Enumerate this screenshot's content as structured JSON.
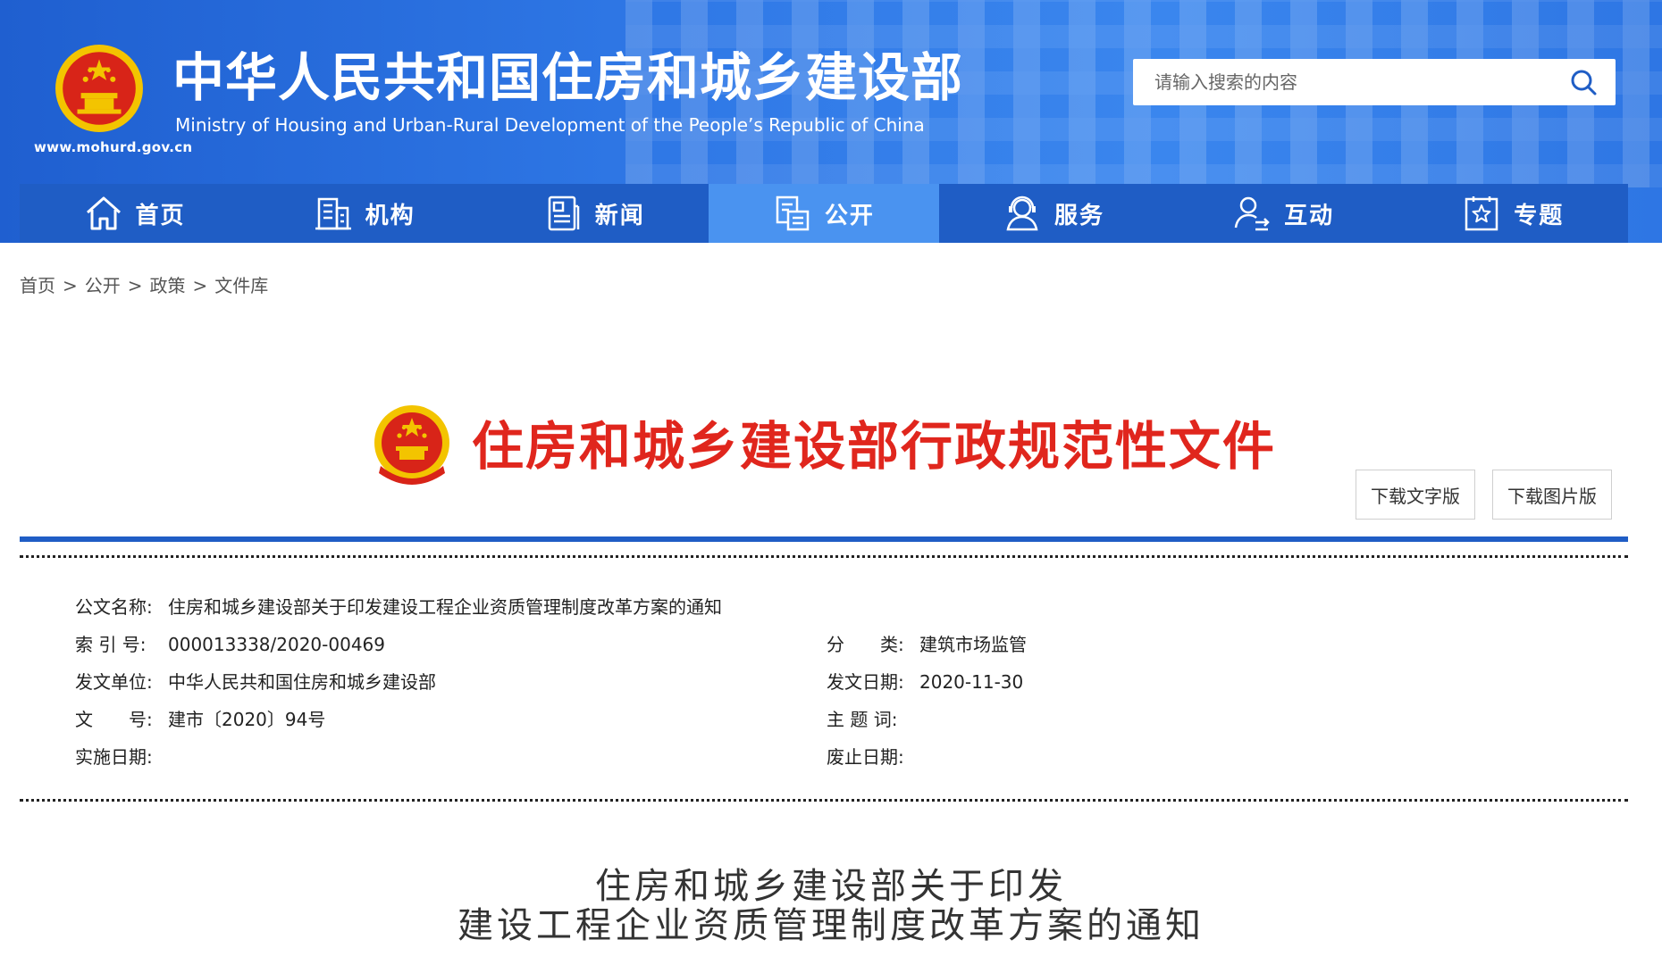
{
  "header": {
    "site_title": "中华人民共和国住房和城乡建设部",
    "site_subtitle": "Ministry of Housing and Urban-Rural Development of the People’s Republic of China",
    "site_url": "www.mohurd.gov.cn",
    "search_placeholder": "请输入搜索的内容"
  },
  "nav": {
    "items": [
      {
        "label": "首页",
        "icon": "home-icon"
      },
      {
        "label": "机构",
        "icon": "building-icon"
      },
      {
        "label": "新闻",
        "icon": "news-icon"
      },
      {
        "label": "公开",
        "icon": "open-files-icon",
        "active": true
      },
      {
        "label": "服务",
        "icon": "service-person-icon"
      },
      {
        "label": "互动",
        "icon": "interaction-user-icon"
      },
      {
        "label": "专题",
        "icon": "topic-star-icon"
      }
    ]
  },
  "breadcrumb": [
    "首页",
    "公开",
    "政策",
    "文件库"
  ],
  "breadcrumb_sep": ">",
  "doc_header": {
    "title": "住房和城乡建设部行政规范性文件",
    "download_text": "下载文字版",
    "download_image": "下载图片版"
  },
  "meta": {
    "name_label": "公文名称:",
    "name_value": "住房和城乡建设部关于印发建设工程企业资质管理制度改革方案的通知",
    "index_label": "索 引 号:",
    "index_value": "000013338/2020-00469",
    "category_label": "分　　类:",
    "category_value": "建筑市场监管",
    "issuer_label": "发文单位:",
    "issuer_value": "中华人民共和国住房和城乡建设部",
    "date_label": "发文日期:",
    "date_value": "2020-11-30",
    "docno_label": "文　　号:",
    "docno_value": "建市〔2020〕94号",
    "subject_label": "主 题 词:",
    "subject_value": "",
    "effective_label": "实施日期:",
    "effective_value": "",
    "expiry_label": "废止日期:",
    "expiry_value": ""
  },
  "notice_title": {
    "line1": "住房和城乡建设部关于印发",
    "line2": "建设工程企业资质管理制度改革方案的通知"
  },
  "colors": {
    "header_blue": "#2f78e6",
    "nav_blue": "#1f5dc5",
    "nav_active": "#4a93f0",
    "heading_red": "#e0261d"
  }
}
